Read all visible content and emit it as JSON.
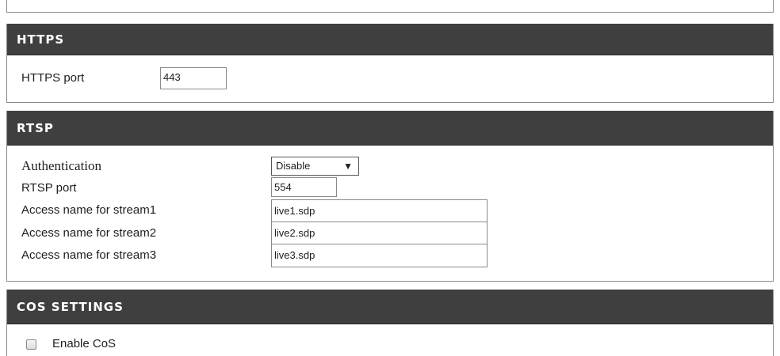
{
  "https": {
    "title": "HTTPS",
    "port_label": "HTTPS port",
    "port_value": "443"
  },
  "rtsp": {
    "title": "RTSP",
    "authentication_label": "Authentication",
    "authentication_value": "Disable",
    "port_label": "RTSP port",
    "port_value": "554",
    "stream1_label": "Access name for stream1",
    "stream1_value": "live1.sdp",
    "stream2_label": "Access name for stream2",
    "stream2_value": "live2.sdp",
    "stream3_label": "Access name for stream3",
    "stream3_value": "live3.sdp"
  },
  "cos": {
    "title": "COS SETTINGS",
    "enable_label": "Enable CoS",
    "enable_checked": false
  },
  "icons": {
    "dropdown": "▼"
  },
  "colors": {
    "header_bg": "#3f3f3f",
    "header_text": "#ffffff",
    "border": "#8a8a8a"
  }
}
